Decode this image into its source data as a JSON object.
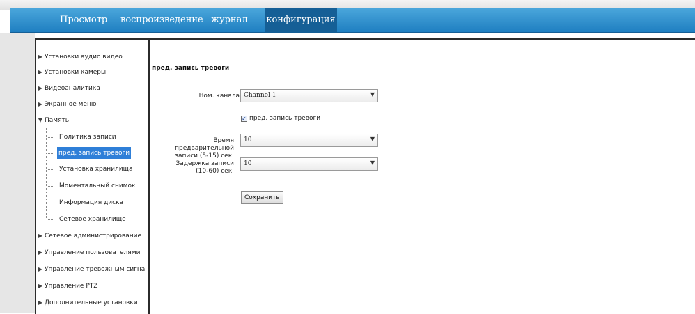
{
  "nav": {
    "tabs": [
      {
        "label": "Просмотр",
        "active": false
      },
      {
        "label": "воспроизведение",
        "active": false
      },
      {
        "label": "журнал",
        "active": false
      },
      {
        "label": "конфигурация",
        "active": true
      }
    ]
  },
  "sidebar": {
    "items": [
      {
        "label": "Установки аудио видео",
        "expanded": false
      },
      {
        "label": "Установки камеры",
        "expanded": false
      },
      {
        "label": "Видеоаналитика",
        "expanded": false
      },
      {
        "label": "Экранное меню",
        "expanded": false
      },
      {
        "label": "Память",
        "expanded": true
      },
      {
        "label": "Сетевое администрирование",
        "expanded": false
      },
      {
        "label": "Управление пользователями",
        "expanded": false
      },
      {
        "label": "Управление тревожным сигналом",
        "expanded": false
      },
      {
        "label": "Управление PTZ",
        "expanded": false
      },
      {
        "label": "Дополнительные установки",
        "expanded": false
      }
    ],
    "memory_children": [
      {
        "label": "Политика записи",
        "selected": false
      },
      {
        "label": "пред. запись тревоги",
        "selected": true
      },
      {
        "label": "Установка хранилища",
        "selected": false
      },
      {
        "label": "Моментальный снимок",
        "selected": false
      },
      {
        "label": "Информация диска",
        "selected": false
      },
      {
        "label": "Сетевое хранилище",
        "selected": false
      }
    ]
  },
  "main": {
    "title": "пред. запись тревоги",
    "channel": {
      "label": "Ном. канала",
      "value": "Channel 1"
    },
    "prerecord_checkbox": {
      "label": "пред. запись тревоги",
      "checked": true
    },
    "prerecord_time": {
      "label_line1": "Время предварительной",
      "label_line2": "записи (5-15) сек.",
      "value": "10"
    },
    "record_delay": {
      "label_line1": "Задержка записи",
      "label_line2": "(10-60) сек.",
      "value": "10"
    },
    "save_label": "Сохранить"
  },
  "colors": {
    "nav": "#2f8fd0",
    "nav_active": "#155f96",
    "selected": "#2f7fd8"
  }
}
